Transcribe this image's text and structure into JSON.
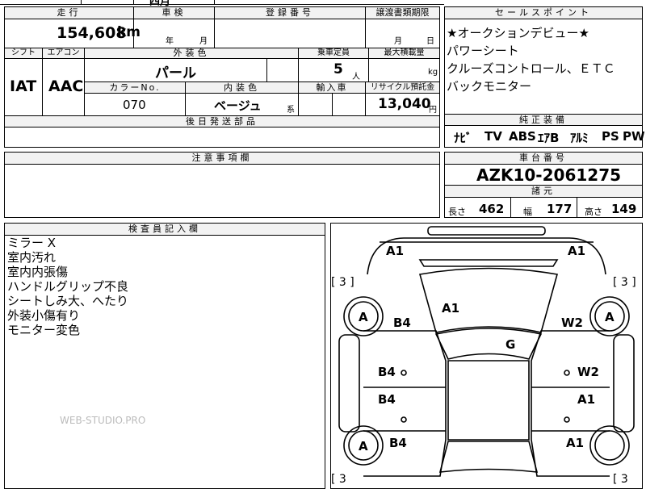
{
  "labels": {
    "mileage": "走行",
    "inspection": "車検",
    "registration": "登録番号",
    "transfer_deadline": "譲渡書類期限",
    "shift": "シフト",
    "aircon": "エアコン",
    "exterior_color": "外装色",
    "capacity": "乗車定員",
    "max_load": "最大積載量",
    "color_no": "カラーNo.",
    "interior_color": "内装色",
    "import": "輸入車",
    "recycle": "リサイクル預託金",
    "later_parts": "後日発送部品",
    "notes": "注意事項欄",
    "inspector_notes": "検査員記入欄",
    "sales_points": "セールスポイント",
    "standard_equipment": "純正装備",
    "chassis_number": "車台番号",
    "specs": "諸元"
  },
  "values": {
    "mileage": "154,608",
    "mileage_unit": "km",
    "year_suffix": "年",
    "month_suffix": "月",
    "day_suffix": "日",
    "shift": "IAT",
    "aircon": "AAC",
    "exterior_color": "パール",
    "capacity": "5",
    "capacity_unit": "人",
    "load_unit": "kg",
    "color_no": "070",
    "interior_color": "ベージュ",
    "interior_suffix": "系",
    "recycle": "13,040",
    "recycle_unit": "円",
    "chassis_number": "AZK10-2061275"
  },
  "top_partial": "四月",
  "sales_points": [
    "★オークションデビュー★",
    "パワーシート",
    "クルーズコントロール、ＥＴＣ",
    "バックモニター"
  ],
  "equipment": [
    "ﾅﾋﾞ",
    "TV",
    "ABS",
    "ｴｱB",
    "ｱﾙﾐ",
    "PS",
    "PW"
  ],
  "specs": {
    "length_label": "長さ",
    "length": "462",
    "width_label": "幅",
    "width": "177",
    "height_label": "高さ",
    "height": "149"
  },
  "inspector_notes": [
    "ミラー X",
    "室内汚れ",
    "室内内張傷",
    "ハンドルグリップ不良",
    "シートしみ大、へたり",
    "外装小傷有り",
    "モニター変色"
  ],
  "watermark": "WEB-STUDIO.PRO",
  "diagram": {
    "marks": {
      "front_left_corner": "A1",
      "front_right_corner": "A1",
      "hood": "A1",
      "roof": "G",
      "left_front_wheel": "A",
      "right_front_wheel": "A",
      "left_rear_wheel": "A",
      "left_fender": "B4",
      "right_fender": "W2",
      "left_front_door": "B4",
      "right_front_door": "W2",
      "left_rear_door": "B4",
      "right_rear_door": "A1",
      "left_rear_quarter": "B4",
      "right_rear_quarter": "A1"
    },
    "bracket_labels": [
      "[ 3 ]",
      "[ 3 ]",
      "[ 3",
      "[ 3"
    ]
  }
}
